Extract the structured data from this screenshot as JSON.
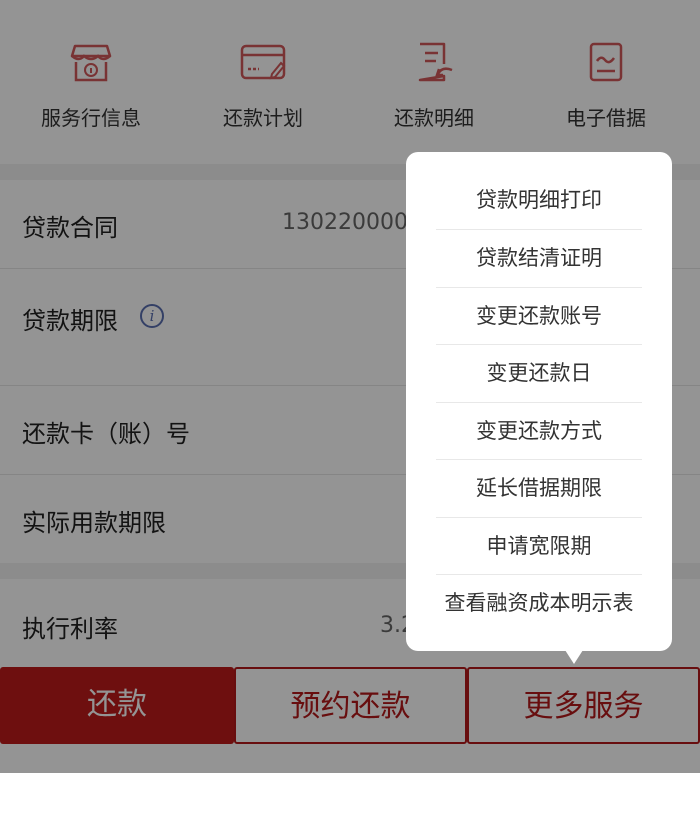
{
  "quick_services": [
    {
      "label": "服务行信息",
      "icon": "bank-branch-icon"
    },
    {
      "label": "还款计划",
      "icon": "repayment-card-icon"
    },
    {
      "label": "还款明细",
      "icon": "repayment-detail-icon"
    },
    {
      "label": "电子借据",
      "icon": "electronic-iou-icon"
    }
  ],
  "details": {
    "contract_label": "贷款合同",
    "contract_value": "130220000",
    "term_label": "贷款期限",
    "term_info_icon": "i",
    "card_label": "还款卡（账）号",
    "usage_label": "实际用款期限",
    "rate_label": "执行利率",
    "rate_value": "3.2"
  },
  "actions": {
    "repay": "还款",
    "appointment": "预约还款",
    "more": "更多服务"
  },
  "more_menu": [
    "贷款明细打印",
    "贷款结清证明",
    "变更还款账号",
    "变更还款日",
    "变更还款方式",
    "延长借据期限",
    "申请宽限期",
    "查看融资成本明示表"
  ],
  "colors": {
    "accent": "#b3191a",
    "icon": "#d0585a"
  }
}
